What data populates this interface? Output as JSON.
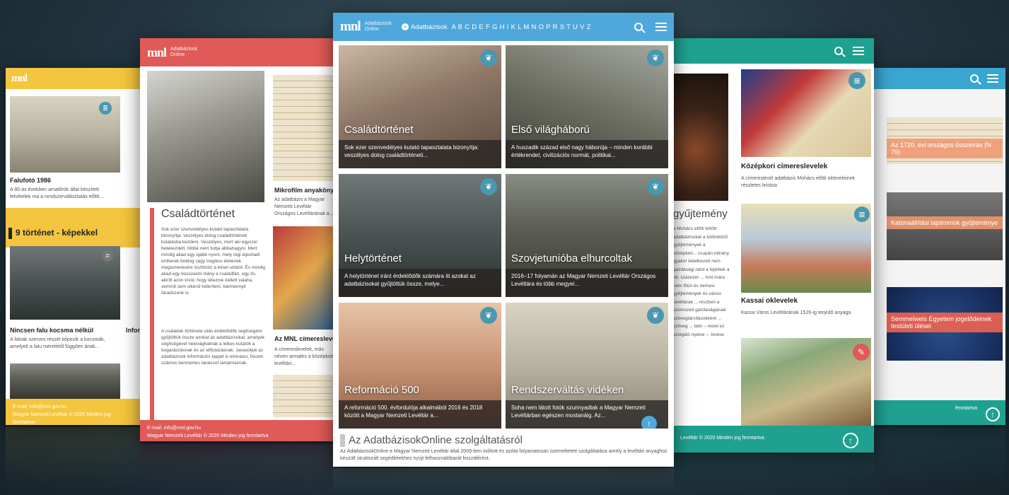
{
  "brand": {
    "logo": "mnl",
    "subtitle_line1": "Adatbázisok",
    "subtitle_line2": "Online"
  },
  "colors": {
    "blue": "#4fa8dc",
    "red": "#e05a57",
    "yellow": "#f4c53e",
    "green": "#1fa191",
    "lightblue": "#3aa5cf"
  },
  "center": {
    "nav_label": "Adatbázisok",
    "alphabet": "A B C D E F G H I K L M N O P R S T U V Z",
    "cards": [
      {
        "title": "Családtörténet",
        "desc": "Sok ezer szenvedélyes kutató tapasztalata bizonyítja: veszélyes dolog családtörténeti..."
      },
      {
        "title": "Első világháború",
        "desc": "A huszadik század első nagy háborúja – minden korábbi értékrendet, civilizációs normát, politikai..."
      },
      {
        "title": "Helytörténet",
        "desc": "A helytörténet iránt érdeklődők számára itt azokat az adatbázisokat gyűjtöttük össze, melye..."
      },
      {
        "title": "Szovjetunióba elhurcoltak",
        "desc": "2016–17 folyamán az Magyar Nemzeti Levéltár Országos Levéltára és több megyei..."
      },
      {
        "title": "Reformáció 500",
        "desc": "A reformáció 500. évfordulója alkalmából 2016 és 2018 között a Magyar Nemzeti Levéltár a..."
      },
      {
        "title": "Rendszerváltás vidéken",
        "desc": "Soha nem látott fotók szunnyadtak a Magyar Nemzeti Levéltárban egészen mostanáig. Az..."
      }
    ],
    "about_title": "Az AdatbázisokOnline szolgáltatásról",
    "about_text": "Az AdatbázisokOnline a Magyar Nemzeti Levéltár által 2009-ben indított és azóta folyamatosan üzemeltetett szolgáltatása amely a levéltári anyaghoz készült strukturált segédletekhez nyújt felhasználóbarát hozzáférést."
  },
  "left_red": {
    "section_title": "Családtörténet",
    "body1": "Sok ezer szenvedélyes kutató tapasztalata bizonyítja: veszélyes dolog családtörténeti kutatásba kezdeni. Veszélyes, mert aki egyszer belekezdett, többé nem tudja abbahagyni. Mert mindig akad egy újabb nyom, mely régi elporladt emberek boldog vagy tragikus életének megismerésére ösztönöz a kései utódot. És mindig akad egy bosszantó hiány a családfán, egy ős, akiről azon kívül, hogy létezniе kellett valaha, semmit sem sikerül kideríteni, bármennyit fáradozunk is.",
    "body2": "A családok története után érdeklődők segítségére gyűjtöttük össze azokat az adatbázisokat, amelyek segítségével nekivághatnak a lelkes kutatók a bogarászásnak és az időutazásnak. Javasoljuk az adatbázisok információs lapjait is elolvasni, hiszen számos benntertes tanácsot tartalmaznak.",
    "mikro_title": "Mikrofilm anyakönyv",
    "mikro_desc": "Az adatbázis a Magyar Nemzeti Levéltár Országos Levéltárának a...",
    "cimer_title": "Az MNL címereslevelek",
    "cimer_desc": "A címereslevelek, más néven armales a középkori levéltári...",
    "footer_email": "E-mail: info@mnl.gov.hu",
    "footer_copy": "Magyar Nemzeti Levéltár © 2020 Minden jog fenntartva"
  },
  "far_left": {
    "card1_title": "Falufotó 1986",
    "card1_desc": "A 80-as években amatőrök által készített felvételek ma a rendszerváltoztatás előtti...",
    "section_title": "9 történet - képekkel",
    "card2_title": "Nincsen falu kocsma nélkül",
    "card2_desc": "A falvak szerves részét képezik a kocsmák, amelyek a falu méretétől függően ának...",
    "card3_title": "Infor",
    "footer_email": "E-mail: info@mnl.gov.hu",
    "footer_copy": "Magyar Nemzeti Levéltár © 2020 Minden jog fenntartva"
  },
  "right_green": {
    "section_title": "gyűjtemény",
    "card1_title": "Középkori címereslevelek",
    "card1_desc": "A címereslevél adatbázis Mohács előtti okleveleinek részletes leírása",
    "card2_title": "Kassai oklevelek",
    "card2_desc": "Kassa Város Levéltárának 1526-ig terjedő anyaga",
    "side_text": "a Mohács előtti kötött adatbázisokat a különböző gyűjtemények a középkori... csupán néhány gyakor keletkezett nem gazdasági ratot a fejlettek a kb. százezer ... Ami mára nem főúri és nemesi gyűjtemények és városi levéltárak ... részben a szomszéd gazdaságainak szövegtársításokként ... szöveg ... latin – mivel ez szolgáló nyelve –, kivéve",
    "footer_copy": "Levéltár © 2020 Minden jog fenntartva"
  },
  "far_right": {
    "card1_title": "Az 1720. évi országos összeírás (N 79)",
    "card2_title": "Katonaállítási lajstromok gyűjteménye",
    "card3_title": "Semmelweis Egyetem jogelődeinek testületi ülései",
    "footer_copy": "fenntartva"
  },
  "icons": [
    "search-icon",
    "menu-icon",
    "leaf-icon",
    "database-icon",
    "arrow-up-icon"
  ]
}
